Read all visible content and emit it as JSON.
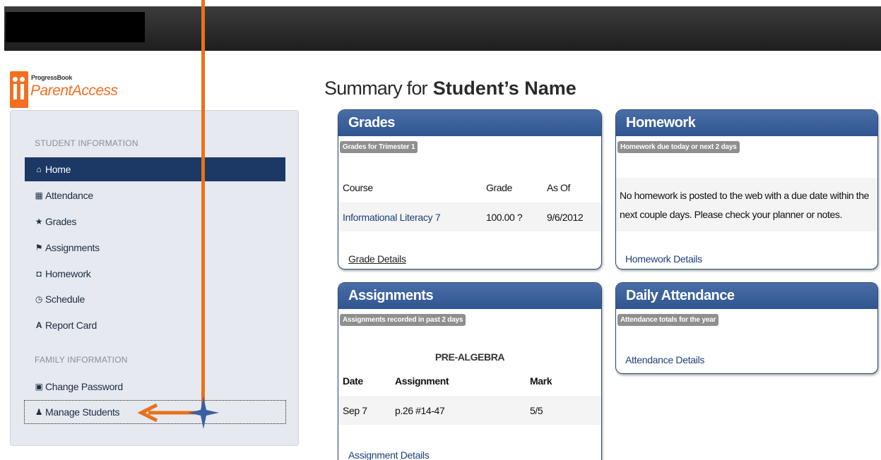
{
  "logo": {
    "small": "ProgressBook",
    "big": "ParentAccess"
  },
  "page_title": {
    "prefix": "Summary for",
    "student": "Student’s Name"
  },
  "sidebar": {
    "student_header": "STUDENT INFORMATION",
    "family_header": "FAMILY INFORMATION",
    "items": [
      {
        "label": "Home",
        "icon": "home-icon"
      },
      {
        "label": "Attendance",
        "icon": "calendar-icon"
      },
      {
        "label": "Grades",
        "icon": "star-icon"
      },
      {
        "label": "Assignments",
        "icon": "flag-icon"
      },
      {
        "label": "Homework",
        "icon": "book-icon"
      },
      {
        "label": "Schedule",
        "icon": "clock-icon"
      },
      {
        "label": "Report Card",
        "icon": "report-card-icon"
      }
    ],
    "family_items": [
      {
        "label": "Change Password",
        "icon": "lock-icon"
      },
      {
        "label": "Manage Students",
        "icon": "user-icon"
      }
    ]
  },
  "grades": {
    "title": "Grades",
    "subtitle": "Grades for Trimester 1",
    "col_course": "Course",
    "col_grade": "Grade",
    "col_asof": "As Of",
    "rows": [
      {
        "course": "Informational Literacy 7",
        "grade": "100.00 ?",
        "asof": "9/6/2012"
      }
    ],
    "details": "Grade Details"
  },
  "homework": {
    "title": "Homework",
    "subtitle": "Homework due today or next 2 days",
    "message_line1": "No homework is posted to the web with a due date within the",
    "message_line2": "next couple days. Please check your planner or notes.",
    "details": "Homework Details"
  },
  "assignments": {
    "title": "Assignments",
    "subtitle": "Assignments recorded in past 2 days",
    "course": "PRE-ALGEBRA",
    "col_date": "Date",
    "col_assignment": "Assignment",
    "col_mark": "Mark",
    "rows": [
      {
        "date": "Sep 7",
        "assignment": "p.26 #14-47",
        "mark": "5/5"
      }
    ],
    "details": "Assignment Details"
  },
  "attendance": {
    "title": "Daily Attendance",
    "subtitle": "Attendance totals for the year",
    "details": "Attendance Details"
  },
  "colors": {
    "accent_orange": "#e8711c",
    "nav_active": "#1c3865",
    "panel_header": "#3a5f99",
    "marker_blue": "#3b5ea3"
  }
}
